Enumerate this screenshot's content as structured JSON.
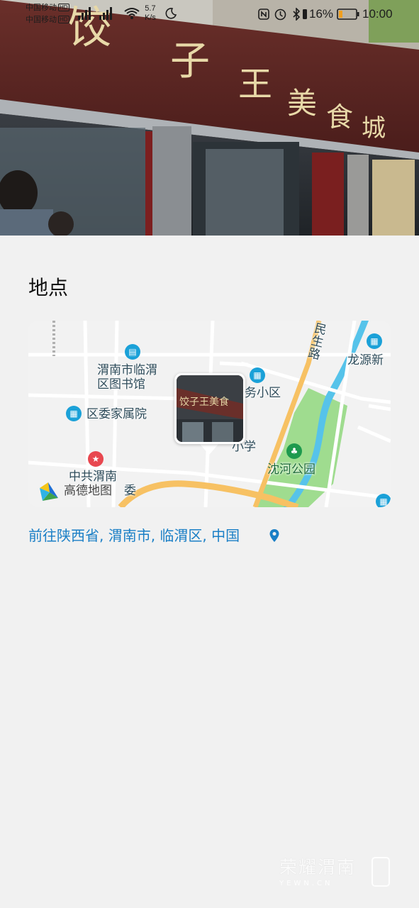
{
  "status_bar": {
    "carrier1": "中国移动",
    "carrier2": "中国移动",
    "hd": "HD",
    "net_speed_value": "5.7",
    "net_speed_unit": "K/s",
    "battery_percent": "16%",
    "time": "10:00",
    "icons": [
      "signal-icon",
      "wifi-icon",
      "moon-icon",
      "nfc-icon",
      "alarm-icon",
      "bluetooth-icon",
      "vibrate-icon",
      "battery-icon"
    ]
  },
  "photo": {
    "sign_text": "饺子王美食城",
    "thumb_sign_text": "饺子王美食"
  },
  "location": {
    "section_title": "地点",
    "address_link": "前往陕西省, 渭南市, 临渭区, 中国",
    "map": {
      "provider": "高德地图",
      "labels": {
        "road": "民生路",
        "library_l1": "渭南市临渭",
        "library_l2": "区图书馆",
        "residence": "务小区",
        "committee": "区委家属院",
        "school": "小学",
        "park": "沈河公园",
        "longyuan": "龙源新",
        "party_l1": "中共渭南",
        "party_l2": "委"
      }
    }
  },
  "watermark": {
    "main": "荣耀渭南",
    "sub": "YEWN.CN"
  },
  "colors": {
    "background": "#f1f1f1",
    "link": "#1a7fc6",
    "river": "#56c3ea",
    "park": "#9fdc8f",
    "main_road": "#f7c163"
  }
}
